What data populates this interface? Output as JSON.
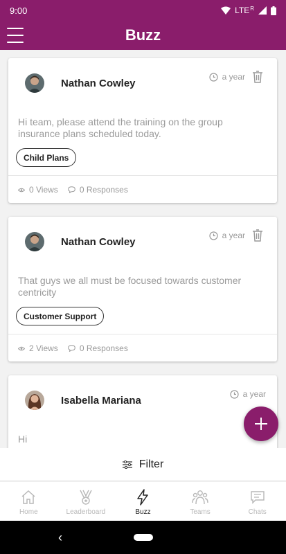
{
  "status": {
    "time": "9:00",
    "network": "LTE",
    "roaming": "R"
  },
  "header": {
    "title": "Buzz"
  },
  "posts": [
    {
      "author": "Nathan Cowley",
      "time": "a year",
      "text": "Hi team, please attend the training on the group insurance plans scheduled today.",
      "tag": "Child Plans",
      "views": "0 Views",
      "responses": "0 Responses",
      "avatar": "male-avatar"
    },
    {
      "author": "Nathan Cowley",
      "time": "a year",
      "text": "That guys we all must be focused towards customer centricity",
      "tag": "Customer Support",
      "views": "2 Views",
      "responses": "0 Responses",
      "avatar": "male-avatar"
    },
    {
      "author": "Isabella Mariana",
      "time": "a year",
      "text": "Hi",
      "avatar": "female-avatar"
    }
  ],
  "filter": {
    "label": "Filter"
  },
  "nav": [
    {
      "label": "Home",
      "icon": "home-icon"
    },
    {
      "label": "Leaderboard",
      "icon": "medal-icon"
    },
    {
      "label": "Buzz",
      "icon": "lightning-icon"
    },
    {
      "label": "Teams",
      "icon": "team-icon"
    },
    {
      "label": "Chats",
      "icon": "chat-icon"
    }
  ],
  "colors": {
    "primary": "#8a1d6b",
    "muted": "#9a9a9a"
  }
}
